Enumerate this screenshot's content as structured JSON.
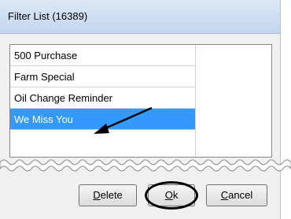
{
  "window": {
    "title": "Filter List (16389)"
  },
  "list": {
    "items": [
      {
        "label": "500 Purchase",
        "selected": false
      },
      {
        "label": "Farm Special",
        "selected": false
      },
      {
        "label": "Oil Change Reminder",
        "selected": false
      },
      {
        "label": "We Miss You",
        "selected": true
      }
    ]
  },
  "buttons": {
    "delete": {
      "mnemonic": "D",
      "rest": "elete"
    },
    "ok": {
      "mnemonic": "O",
      "rest": "k"
    },
    "cancel": {
      "mnemonic": "C",
      "rest": "ancel"
    }
  },
  "colors": {
    "selection": "#3399ff",
    "titlebar": "#c3d6ee"
  }
}
